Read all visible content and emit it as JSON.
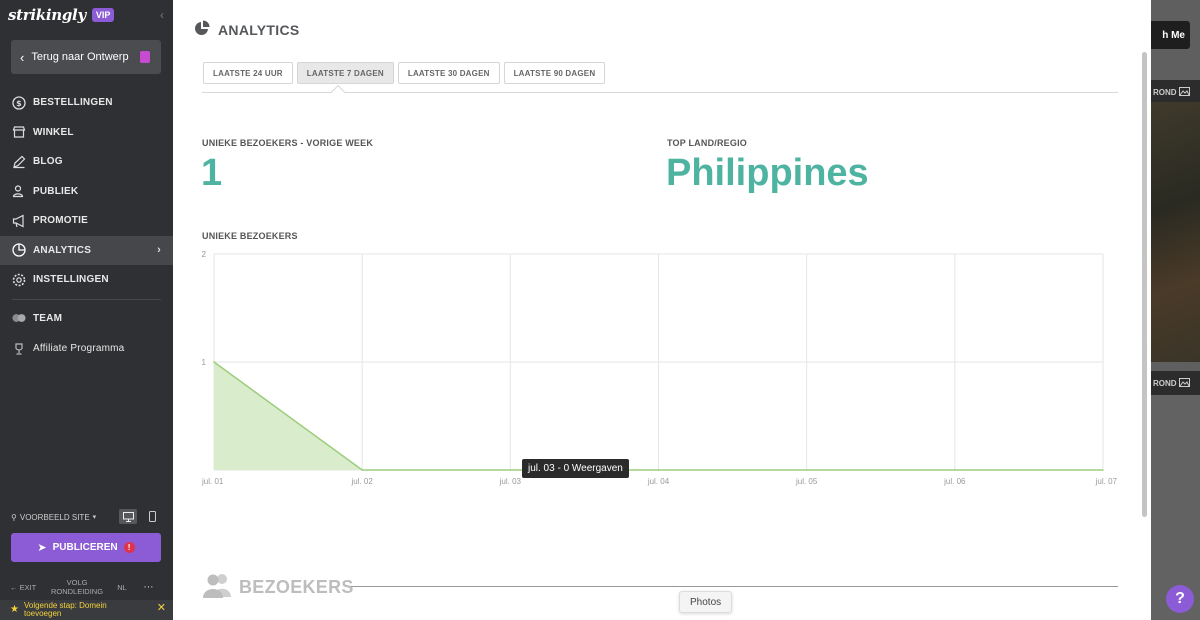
{
  "sidebar": {
    "logo": "strikingly",
    "badge": "VIP",
    "back_label": "Terug naar Ontwerp",
    "items": [
      {
        "label": "BESTELLINGEN",
        "icon": "dollar-circle-icon"
      },
      {
        "label": "WINKEL",
        "icon": "store-icon"
      },
      {
        "label": "BLOG",
        "icon": "pen-icon"
      },
      {
        "label": "PUBLIEK",
        "icon": "users-icon"
      },
      {
        "label": "PROMOTIE",
        "icon": "megaphone-icon"
      },
      {
        "label": "ANALYTICS",
        "icon": "pie-chart-icon",
        "active": true
      },
      {
        "label": "INSTELLINGEN",
        "icon": "gear-icon"
      }
    ],
    "team_label": "TEAM",
    "affiliate_label": "Affiliate Programma",
    "preview_label": "VOORBEELD SITE",
    "publish_label": "PUBLICEREN",
    "publish_warning": "!",
    "exit_label": "EXIT",
    "tour_label": "VOLG RONDLEIDING",
    "lang_label": "NL",
    "next_step": "Volgende stap: Domein toevoegen"
  },
  "main": {
    "title": "ANALYTICS",
    "tabs": [
      {
        "label": "LAATSTE 24 UUR",
        "active": false
      },
      {
        "label": "LAATSTE 7 DAGEN",
        "active": true
      },
      {
        "label": "LAATSTE 30 DAGEN",
        "active": false
      },
      {
        "label": "LAATSTE 90 DAGEN",
        "active": false
      }
    ],
    "stat1": {
      "label": "UNIEKE BEZOEKERS - VORIGE WEEK",
      "value": "1"
    },
    "stat2": {
      "label": "TOP LAND/REGIO",
      "value": "Philippines"
    },
    "chart_title": "UNIEKE BEZOEKERS",
    "tooltip": "jul. 03 - 0 Weergaven",
    "section2_title": "BEZOEKERS",
    "photos_label": "Photos"
  },
  "peek": {
    "button_text": "h Me",
    "bar1": "ROND",
    "bar2": "ROND",
    "help": "?"
  },
  "colors": {
    "accent": "#4fb3a2",
    "brand": "#8c5cd6",
    "sidebar_bg": "#2f3033",
    "area_fill": "#d9eccb",
    "area_line": "#9ccd7d"
  },
  "chart_data": {
    "type": "area",
    "categories": [
      "jul. 01",
      "jul. 02",
      "jul. 03",
      "jul. 04",
      "jul. 05",
      "jul. 06",
      "jul. 07"
    ],
    "values": [
      1,
      0,
      0,
      0,
      0,
      0,
      0
    ],
    "yticks": [
      1,
      2
    ],
    "ylim": [
      0,
      2
    ],
    "title": "UNIEKE BEZOEKERS",
    "xlabel": "",
    "ylabel": "",
    "grid": true,
    "legend": "none"
  }
}
